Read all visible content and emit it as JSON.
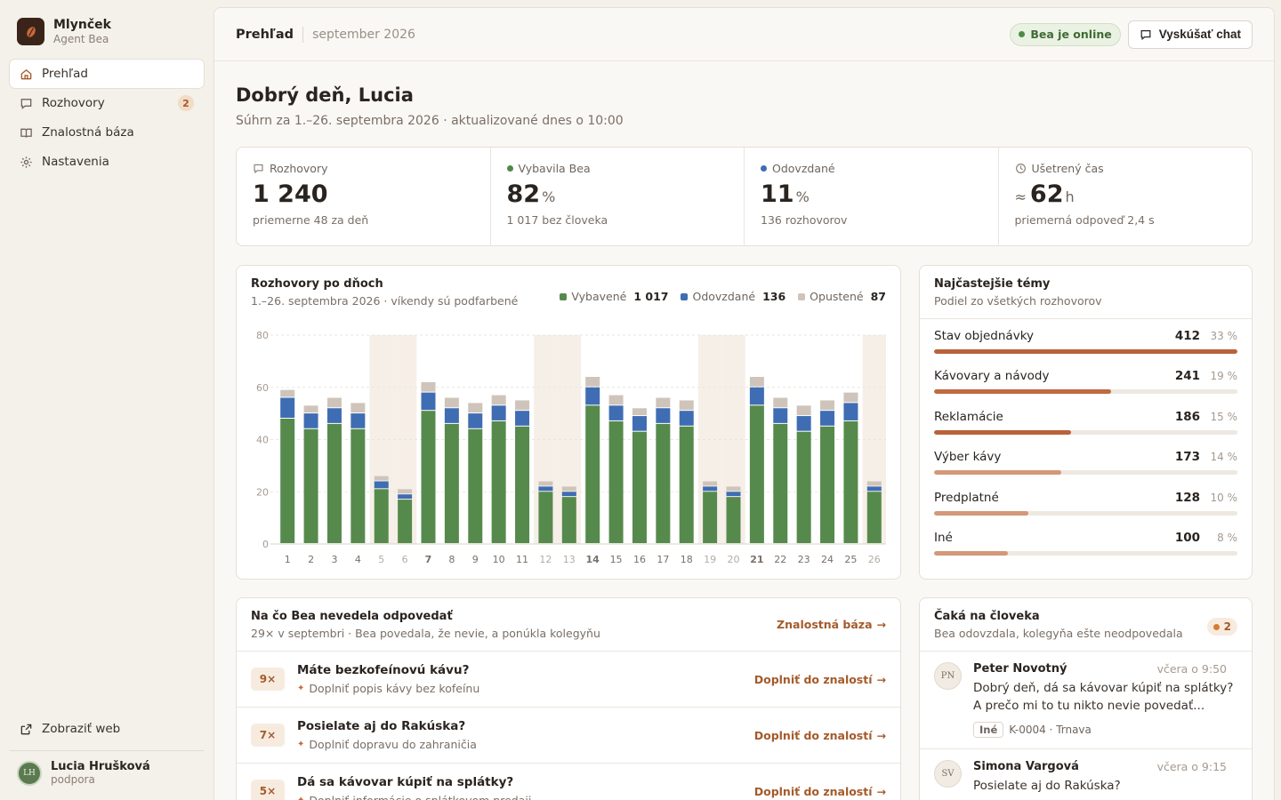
{
  "brand": {
    "name": "Mlynček",
    "subtitle": "Agent Bea"
  },
  "nav": {
    "items": [
      {
        "label": "Prehľad",
        "icon": "home-icon",
        "active": true
      },
      {
        "label": "Rozhovory",
        "icon": "chat-icon",
        "badge": "2"
      },
      {
        "label": "Znalostná báza",
        "icon": "book-icon"
      },
      {
        "label": "Nastavenia",
        "icon": "gear-icon"
      }
    ],
    "web_link": "Zobraziť web"
  },
  "user": {
    "initials": "LH",
    "name": "Lucia Hrušková",
    "role": "podpora"
  },
  "topbar": {
    "title": "Prehľad",
    "date": "september 2026",
    "online": "Bea je online",
    "try_chat": "Vyskúšať chat"
  },
  "greeting": {
    "title": "Dobrý deň, Lucia",
    "summary": "Súhrn za 1.–26. septembra 2026 · aktualizované dnes o 10:00"
  },
  "stats": [
    {
      "label": "Rozhovory",
      "value": "1 240",
      "unit": "",
      "sub": "priemerne 48 za deň"
    },
    {
      "label": "Vybavila Bea",
      "value": "82",
      "unit": "%",
      "sub": "1 017 bez človeka"
    },
    {
      "label": "Odovzdané",
      "value": "11",
      "unit": "%",
      "sub": "136 rozhovorov"
    },
    {
      "label": "Ušetrený čas",
      "prefix": "≈",
      "value": "62",
      "unit": "h",
      "sub": "priemerná odpoveď 2,4 s"
    }
  ],
  "chart_card": {
    "title": "Rozhovory po dňoch",
    "subtitle": "1.–26. septembra 2026 · víkendy sú podfarbené",
    "legend": [
      {
        "name": "Vybavené",
        "total": "1 017"
      },
      {
        "name": "Odovzdané",
        "total": "136"
      },
      {
        "name": "Opustené",
        "total": "87"
      }
    ]
  },
  "chart_data": {
    "type": "bar",
    "stacked": true,
    "categories": [
      "1",
      "2",
      "3",
      "4",
      "5",
      "6",
      "7",
      "8",
      "9",
      "10",
      "11",
      "12",
      "13",
      "14",
      "15",
      "16",
      "17",
      "18",
      "19",
      "20",
      "21",
      "22",
      "23",
      "24",
      "25",
      "26"
    ],
    "weekend_categories": [
      "5",
      "6",
      "12",
      "13",
      "19",
      "20",
      "26"
    ],
    "series": [
      {
        "name": "Vybavené",
        "color": "#568a4c",
        "values": [
          48,
          44,
          46,
          44,
          21,
          17,
          51,
          46,
          44,
          47,
          45,
          20,
          18,
          53,
          47,
          43,
          46,
          45,
          20,
          18,
          53,
          46,
          43,
          45,
          47,
          20
        ]
      },
      {
        "name": "Odovzdané",
        "color": "#3f6db3",
        "values": [
          8,
          6,
          6,
          6,
          3,
          2,
          7,
          6,
          6,
          6,
          6,
          2,
          2,
          7,
          6,
          6,
          6,
          6,
          2,
          2,
          7,
          6,
          6,
          6,
          7,
          2
        ]
      },
      {
        "name": "Opustené",
        "color": "#cfc4ba",
        "values": [
          3,
          3,
          4,
          4,
          2,
          2,
          4,
          4,
          4,
          4,
          4,
          2,
          2,
          4,
          4,
          3,
          4,
          4,
          2,
          2,
          4,
          4,
          4,
          4,
          4,
          2
        ]
      }
    ],
    "ylim": [
      0,
      80
    ],
    "yticks": [
      0,
      20,
      40,
      60,
      80
    ],
    "grid": true,
    "legend_position": "top-right"
  },
  "topics": {
    "title": "Najčastejšie témy",
    "subtitle": "Podiel zo všetkých rozhovorov",
    "items": [
      {
        "name": "Stav objednávky",
        "count": "412",
        "pct": "33 %",
        "share": 1.0,
        "color": "#b9623a"
      },
      {
        "name": "Kávovary a návody",
        "count": "241",
        "pct": "19 %",
        "share": 0.585,
        "color": "#bf6a40"
      },
      {
        "name": "Reklamácie",
        "count": "186",
        "pct": "15 %",
        "share": 0.451,
        "color": "#b9623a"
      },
      {
        "name": "Výber kávy",
        "count": "173",
        "pct": "14 %",
        "share": 0.42,
        "color": "#d39878"
      },
      {
        "name": "Predplatné",
        "count": "128",
        "pct": "10 %",
        "share": 0.311,
        "color": "#d39878"
      },
      {
        "name": "Iné",
        "count": "100",
        "pct": "8 %",
        "share": 0.243,
        "color": "#d39878"
      }
    ]
  },
  "unanswered": {
    "title": "Na čo Bea nevedela odpovedať",
    "subtitle": "29× v septembri · Bea povedala, že nevie, a ponúkla kolegyňu",
    "link": "Znalostná báza",
    "items": [
      {
        "count": "9×",
        "question": "Máte bezkofeínovú kávu?",
        "hint": "Doplniť popis kávy bez kofeínu",
        "action": "Doplniť do znalostí"
      },
      {
        "count": "7×",
        "question": "Posielate aj do Rakúska?",
        "hint": "Doplniť dopravu do zahraničia",
        "action": "Doplniť do znalostí"
      },
      {
        "count": "5×",
        "question": "Dá sa kávovar kúpiť na splátky?",
        "hint": "Doplniť informácie o splátkovom predaji",
        "action": "Doplniť do znalostí"
      }
    ]
  },
  "waiting": {
    "title": "Čaká na človeka",
    "subtitle": "Bea odovzdala, kolegyňa ešte neodpovedala",
    "count": "2",
    "items": [
      {
        "initials": "PN",
        "name": "Peter Novotný",
        "time": "včera o 9:50",
        "text": "Dobrý deň, dá sa kávovar kúpiť na splátky? A prečo mi to tu nikto nevie povedať...",
        "tag": "Iné",
        "ref": "K-0004 · Trnava"
      },
      {
        "initials": "SV",
        "name": "Simona Vargová",
        "time": "včera o 9:15",
        "text": "Posielate aj do Rakúska?",
        "tag": "",
        "ref": ""
      }
    ]
  }
}
